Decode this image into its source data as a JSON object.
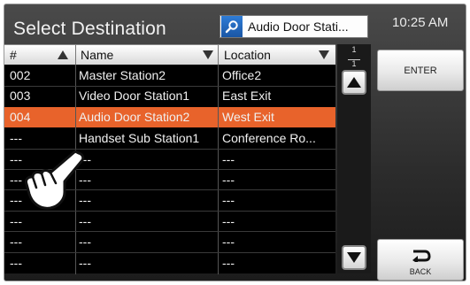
{
  "header": {
    "title": "Select Destination",
    "search_value": "Audio Door Stati...",
    "time": "10:25 AM"
  },
  "table": {
    "columns": [
      {
        "label": "#",
        "sort": "ascending"
      },
      {
        "label": "Name",
        "sort": "descending"
      },
      {
        "label": "Location",
        "sort": "descending"
      }
    ],
    "rows": [
      {
        "num": "002",
        "name": "Master Station2",
        "location": "Office2"
      },
      {
        "num": "003",
        "name": "Video Door Station1",
        "location": "East Exit"
      },
      {
        "num": "004",
        "name": "Audio Door Station2",
        "location": "West Exit"
      },
      {
        "num": "---",
        "name": "Handset Sub Station1",
        "location": "Conference Ro..."
      },
      {
        "num": "---",
        "name": "---",
        "location": "---"
      },
      {
        "num": "---",
        "name": "---",
        "location": "---"
      },
      {
        "num": "---",
        "name": "---",
        "location": "---"
      },
      {
        "num": "---",
        "name": "---",
        "location": "---"
      },
      {
        "num": "---",
        "name": "---",
        "location": "---"
      },
      {
        "num": "---",
        "name": "---",
        "location": "---"
      }
    ],
    "selected_index": 2
  },
  "pagination": {
    "current": "1",
    "total": "1"
  },
  "buttons": {
    "enter": "ENTER",
    "back": "BACK"
  },
  "colors": {
    "selected_row": "#e8632b",
    "search_button": "#1f66bd"
  },
  "icons": [
    "search-icon",
    "scroll-up-icon",
    "scroll-down-icon",
    "back-arrow-icon",
    "pointing-hand-icon"
  ]
}
